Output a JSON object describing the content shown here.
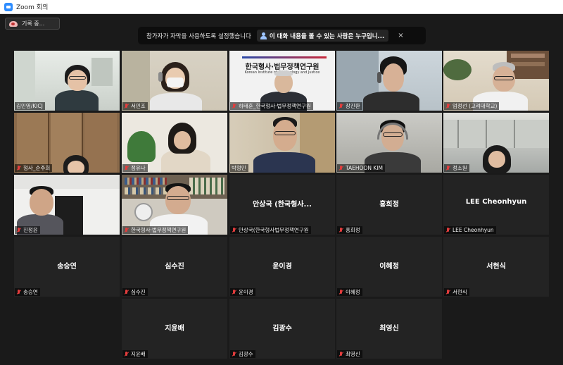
{
  "window": {
    "title": "Zoom 회의"
  },
  "toolbar": {
    "recording_label": "기록 중..."
  },
  "notice": {
    "message": "참가자가 자막을 사용하도록 설정했습니다",
    "who_can_see": "이 대화 내용을 볼 수 있는 사람은 누구입니...",
    "close": "×"
  },
  "participants": [
    {
      "name": "김민영/KICJ",
      "video": true,
      "active": true,
      "muted": false
    },
    {
      "name": "서민조",
      "video": true,
      "muted": true
    },
    {
      "name": "하태훈_한국형사·법무정책연구원",
      "video": true,
      "muted": true,
      "backdrop_text": "한국형사·법무정책연구원",
      "backdrop_sub": "Korean Institute of Criminology and Justice"
    },
    {
      "name": "장진환",
      "video": true,
      "muted": true
    },
    {
      "name": "엄정선 (고려대학교)",
      "video": true,
      "muted": true
    },
    {
      "name": "형사_순주희",
      "video": true,
      "muted": true
    },
    {
      "name": "정유나",
      "video": true,
      "muted": true
    },
    {
      "name": "박형민",
      "video": true,
      "muted": false
    },
    {
      "name": "TAEHOON KIM",
      "video": true,
      "muted": true
    },
    {
      "name": "정소원",
      "video": true,
      "muted": true
    },
    {
      "name": "진정윤",
      "video": true,
      "muted": true
    },
    {
      "name": "한국형사·법무정책연구원",
      "video": true,
      "muted": true
    },
    {
      "name": "안상국(한국형사법무정책연구원",
      "display": "안상국 (한국형사...",
      "video": false,
      "muted": true
    },
    {
      "name": "홍희정",
      "display": "홍희정",
      "video": false,
      "muted": true
    },
    {
      "name": "LEE Cheonhyun",
      "display": "LEE Cheonhyun",
      "video": false,
      "muted": true
    },
    {
      "name": "송승연",
      "display": "송승연",
      "video": false,
      "muted": true
    },
    {
      "name": "심수진",
      "display": "심수진",
      "video": false,
      "muted": true
    },
    {
      "name": "윤이경",
      "display": "윤이경",
      "video": false,
      "muted": true
    },
    {
      "name": "이혜정",
      "display": "이혜정",
      "video": false,
      "muted": true
    },
    {
      "name": "서현식",
      "display": "서현식",
      "video": false,
      "muted": true
    },
    {
      "name": "지윤배",
      "display": "지윤배",
      "video": false,
      "muted": true
    },
    {
      "name": "김광수",
      "display": "김광수",
      "video": false,
      "muted": true
    },
    {
      "name": "최영신",
      "display": "최영신",
      "video": false,
      "muted": true
    }
  ],
  "colors": {
    "active_speaker": "#d8e24a",
    "muted_mic": "#e23d3d",
    "tile_bg": "#232323",
    "stage_bg": "#1a1a1a"
  }
}
